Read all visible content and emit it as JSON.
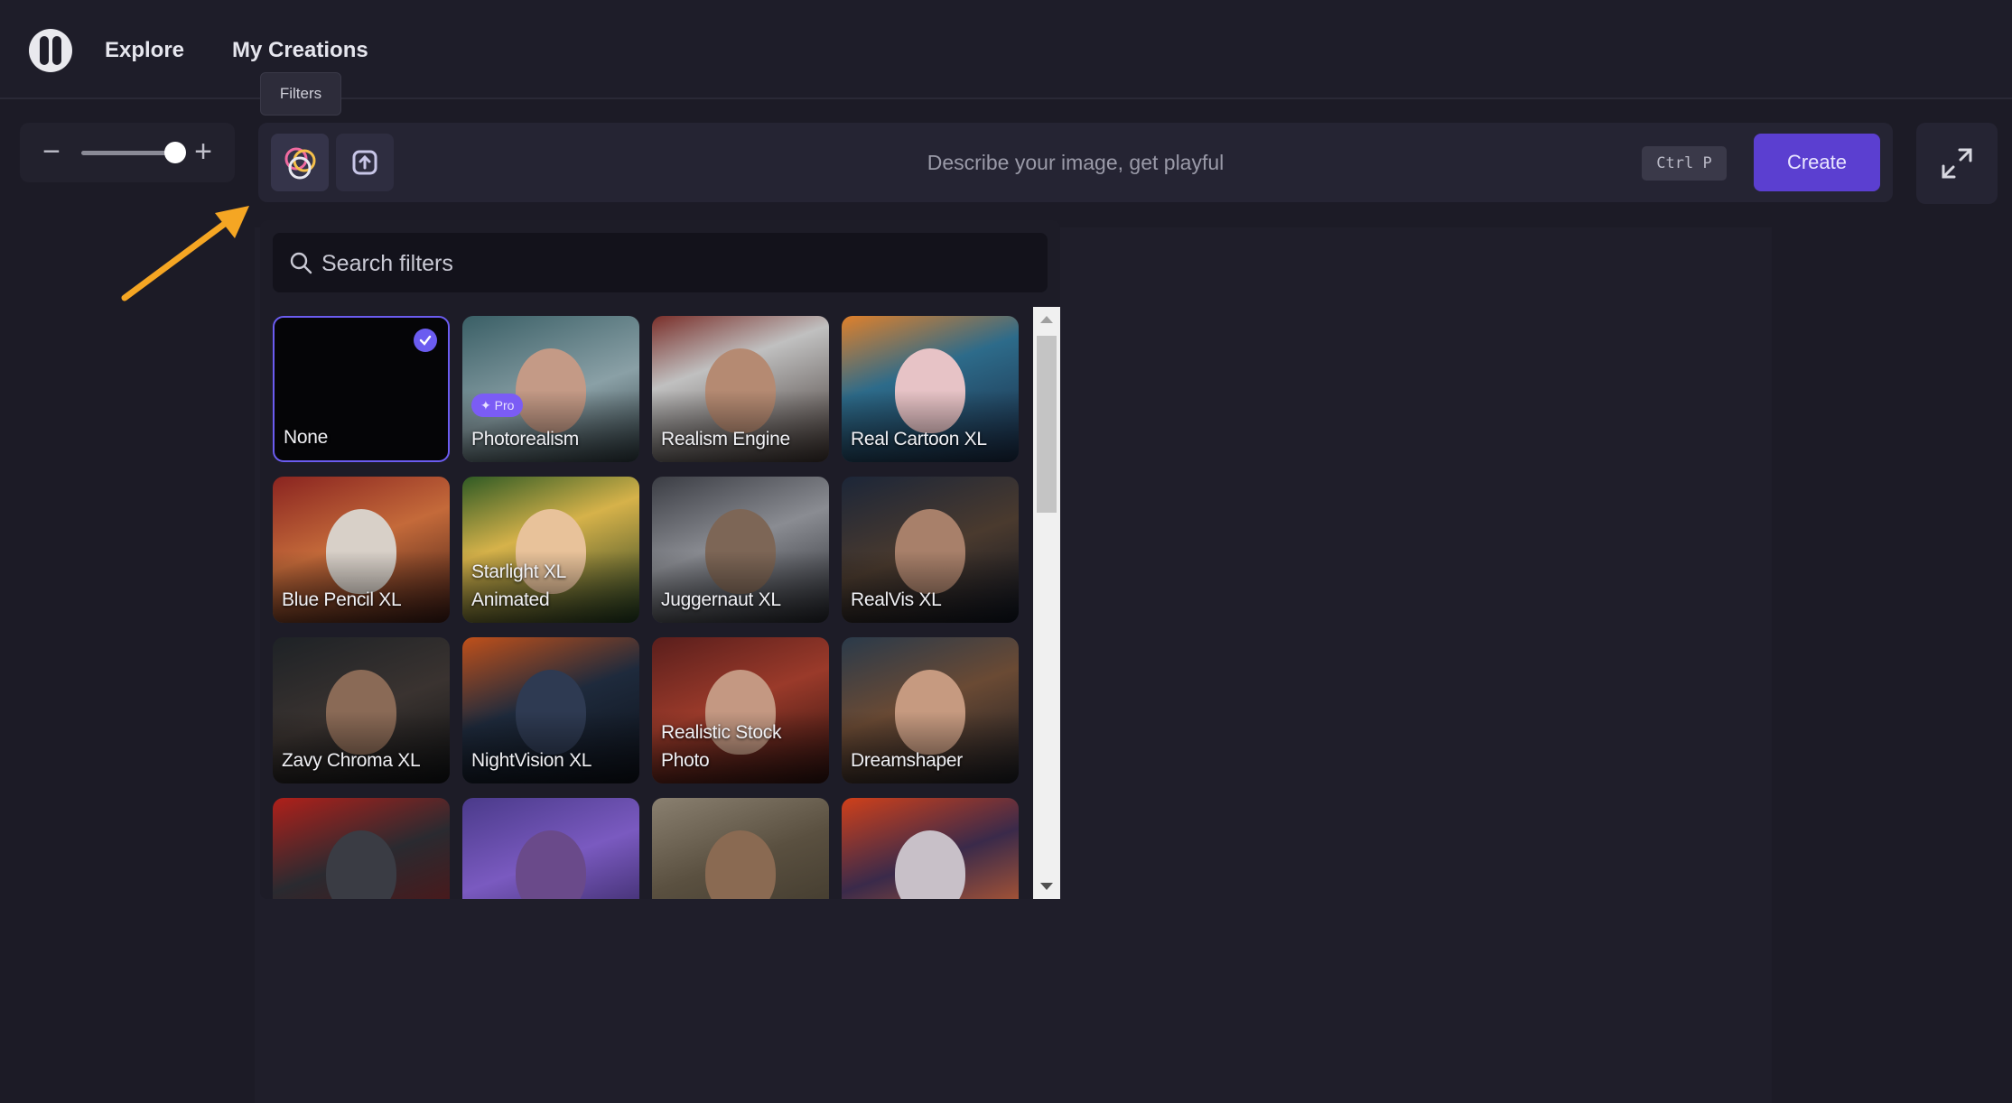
{
  "nav": {
    "explore": "Explore",
    "my_creations": "My Creations"
  },
  "tooltip": "Filters",
  "prompt": {
    "placeholder": "Describe your image, get playful",
    "shortcut": "Ctrl P",
    "create_label": "Create"
  },
  "zoom": {
    "minus": "−",
    "plus": "+",
    "level": 0.9
  },
  "search": {
    "placeholder": "Search filters"
  },
  "filters": [
    {
      "label": "None",
      "selected": true
    },
    {
      "label": "Photorealism",
      "badge": "✦ Pro"
    },
    {
      "label": "Realism Engine"
    },
    {
      "label": "Real Cartoon XL"
    },
    {
      "label": "Blue Pencil XL"
    },
    {
      "label": "Starlight XL Animated"
    },
    {
      "label": "Juggernaut XL"
    },
    {
      "label": "RealVis XL"
    },
    {
      "label": "Zavy Chroma XL"
    },
    {
      "label": "NightVision XL"
    },
    {
      "label": "Realistic Stock Photo"
    },
    {
      "label": "Dreamshaper"
    },
    {
      "label": ""
    },
    {
      "label": ""
    },
    {
      "label": ""
    },
    {
      "label": ""
    }
  ],
  "colors": {
    "accent": "#5b3fd0",
    "selected_border": "#6b5cf0",
    "arrow": "#f5a623"
  }
}
